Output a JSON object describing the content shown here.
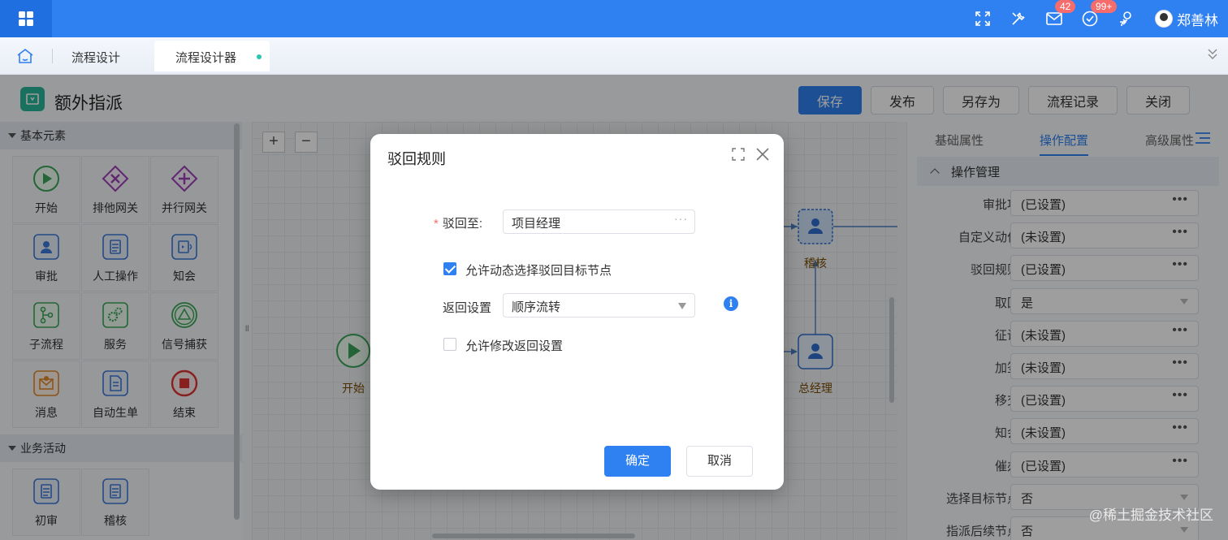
{
  "topbar": {
    "icons": [
      "apps-icon",
      "fullscreen-icon",
      "tools-icon",
      "mail-icon",
      "task-check-icon",
      "user-switch-icon"
    ],
    "mail_badge": "42",
    "task_badge": "99+",
    "user_name": "郑善林"
  },
  "tabs": {
    "tab1": "流程设计",
    "tab2": "流程设计器"
  },
  "page": {
    "title": "额外指派",
    "buttons": {
      "save": "保存",
      "publish": "发布",
      "save_as": "另存为",
      "history": "流程记录",
      "close": "关闭"
    }
  },
  "palette": {
    "section1": "基本元素",
    "items1": [
      {
        "label": "开始",
        "icon": "start-icon"
      },
      {
        "label": "排他网关",
        "icon": "exclusive-gateway-icon"
      },
      {
        "label": "并行网关",
        "icon": "parallel-gateway-icon"
      },
      {
        "label": "审批",
        "icon": "approval-icon"
      },
      {
        "label": "人工操作",
        "icon": "manual-task-icon"
      },
      {
        "label": "知会",
        "icon": "notify-icon"
      },
      {
        "label": "子流程",
        "icon": "subprocess-icon"
      },
      {
        "label": "服务",
        "icon": "service-icon"
      },
      {
        "label": "信号捕获",
        "icon": "signal-catch-icon"
      },
      {
        "label": "消息",
        "icon": "message-icon"
      },
      {
        "label": "自动生单",
        "icon": "auto-order-icon"
      },
      {
        "label": "结束",
        "icon": "end-icon"
      }
    ],
    "section2": "业务活动",
    "items2": [
      {
        "label": "初审",
        "icon": "first-review-icon"
      },
      {
        "label": "稽核",
        "icon": "audit-icon"
      }
    ]
  },
  "canvas": {
    "zoom_in": "+",
    "zoom_out": "−",
    "nodes": {
      "start": "开始",
      "audit": "稽核",
      "gm": "总经理"
    }
  },
  "rpanel": {
    "tabs": [
      "基础属性",
      "操作配置",
      "高级属性"
    ],
    "active_tab": "操作配置",
    "group": "操作管理",
    "rows": [
      {
        "label": "审批项",
        "value": "(已设置)",
        "kind": "more"
      },
      {
        "label": "自定义动作",
        "value": "(未设置)",
        "kind": "more"
      },
      {
        "label": "驳回规则",
        "value": "(已设置)",
        "kind": "more"
      },
      {
        "label": "取回",
        "value": "是",
        "kind": "select"
      },
      {
        "label": "征询",
        "value": "(未设置)",
        "kind": "more"
      },
      {
        "label": "加签",
        "value": "(未设置)",
        "kind": "more"
      },
      {
        "label": "移交",
        "value": "(已设置)",
        "kind": "more"
      },
      {
        "label": "知会",
        "value": "(未设置)",
        "kind": "more"
      },
      {
        "label": "催办",
        "value": "(已设置)",
        "kind": "more"
      },
      {
        "label": "选择目标节点",
        "value": "否",
        "kind": "select"
      },
      {
        "label": "指派后续节点",
        "value": "否",
        "kind": "select"
      }
    ]
  },
  "modal": {
    "title": "驳回规则",
    "reject_to_label": "驳回至:",
    "reject_to_value": "项目经理",
    "dynamic_select_label": "允许动态选择驳回目标节点",
    "dynamic_select_checked": true,
    "return_label": "返回设置",
    "return_value": "顺序流转",
    "allow_modify_label": "允许修改返回设置",
    "allow_modify_checked": false,
    "ok": "确定",
    "cancel": "取消"
  },
  "watermark": "@稀土掘金技术社区",
  "colors": {
    "primary": "#2f80f0",
    "topbar": "#2f80f0",
    "badge": "#f56c6c"
  }
}
